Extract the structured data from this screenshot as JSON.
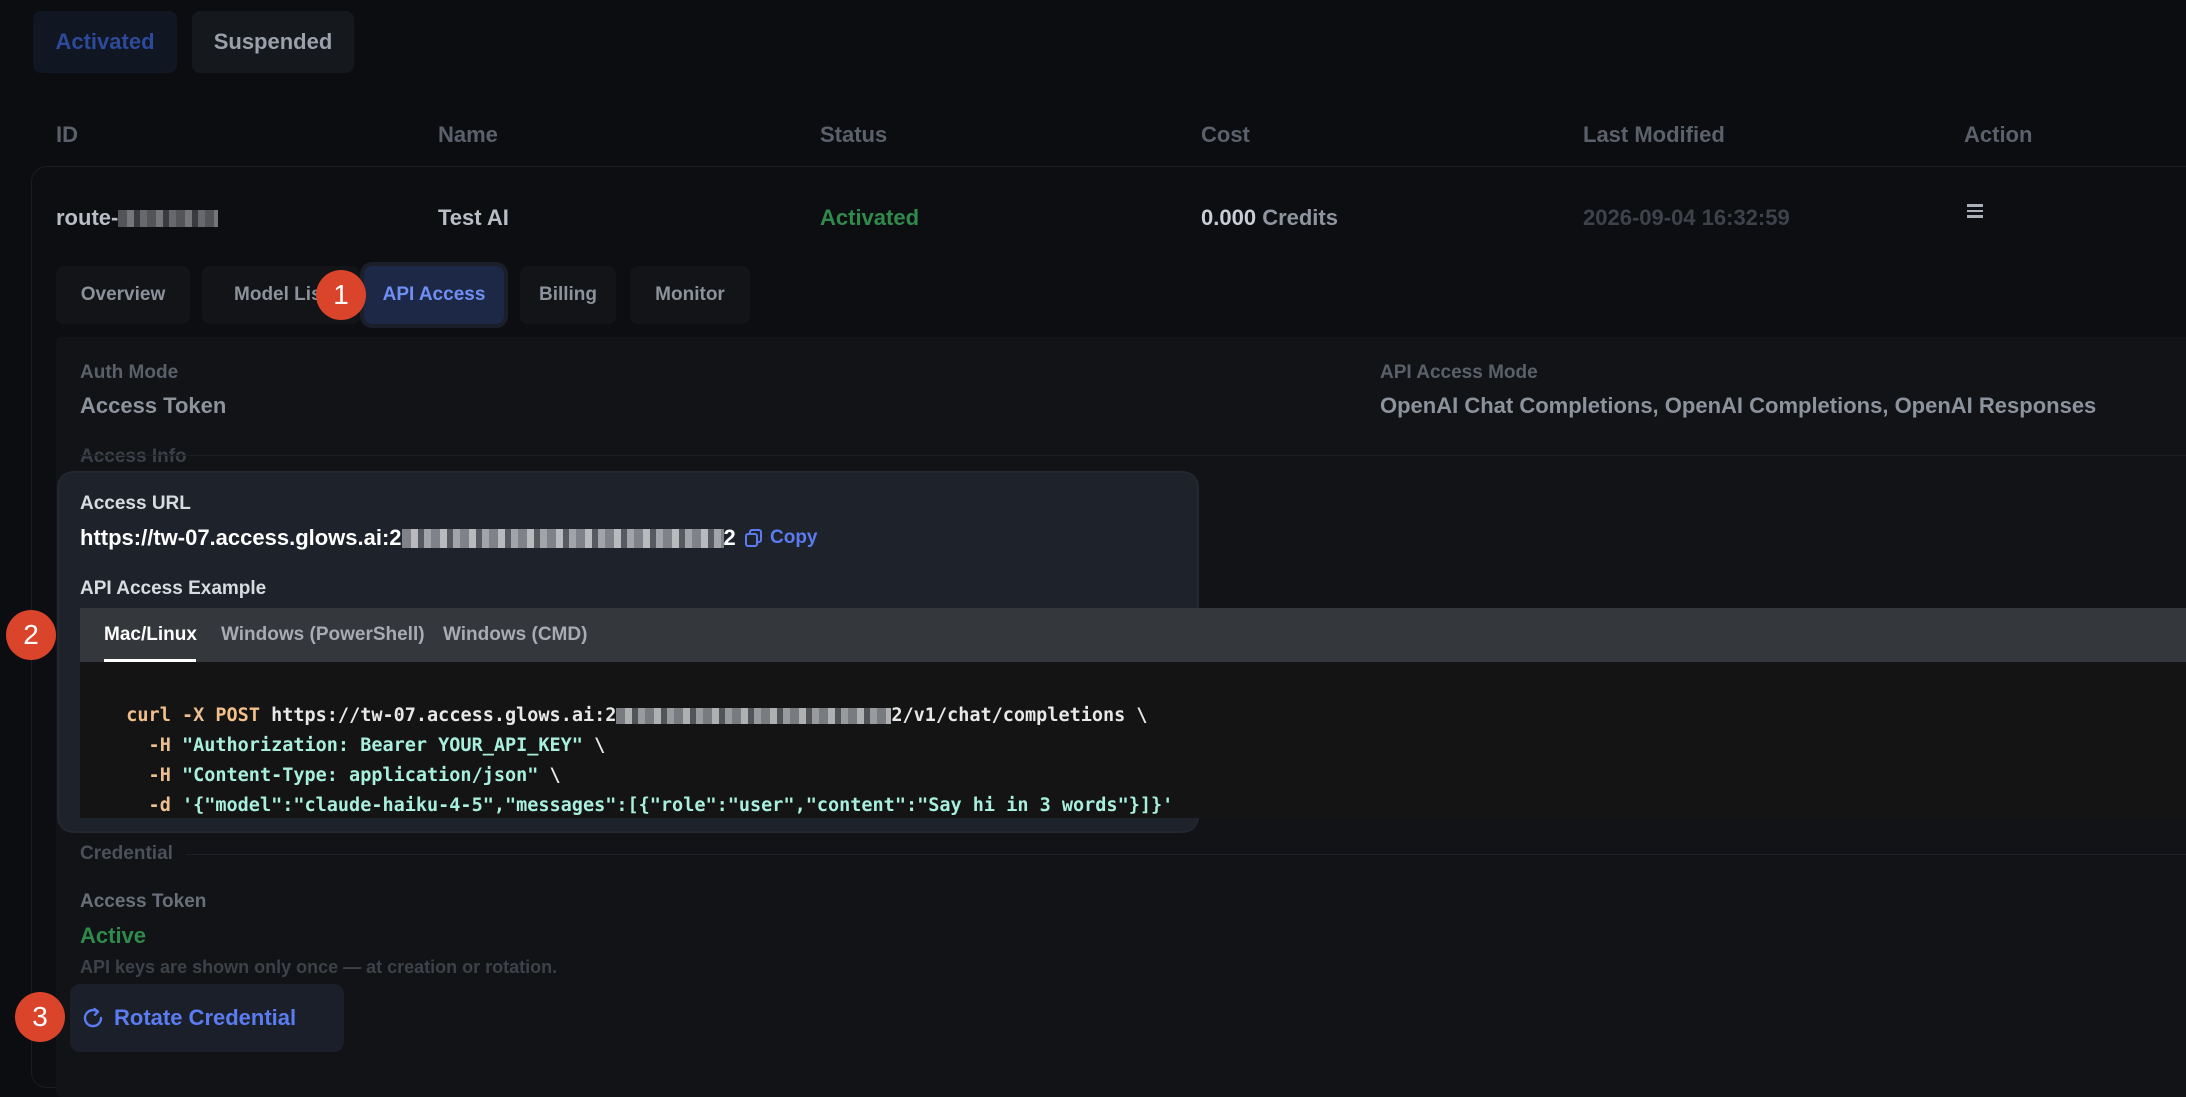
{
  "status_tabs": {
    "activated": "Activated",
    "suspended": "Suspended"
  },
  "table": {
    "headers": [
      "ID",
      "Name",
      "Status",
      "Cost",
      "Last Modified",
      "Action"
    ],
    "row": {
      "id": "route-",
      "name": "Test AI",
      "status": "Activated",
      "cost_value": "0.000",
      "cost_unit": "Credits",
      "last_modified": "2026-09-04 16:32:59",
      "action_icon": "menu-icon"
    }
  },
  "sub_tabs": [
    "Overview",
    "Model List",
    "API Access",
    "Billing",
    "Monitor"
  ],
  "api_access": {
    "auth_mode_label": "Auth Mode",
    "auth_mode_value": "Access Token",
    "api_mode_label": "API Access Mode",
    "api_mode_value": "OpenAI Chat Completions, OpenAI Completions, OpenAI Responses",
    "access_info_label": "Access Info",
    "access_url_label": "Access URL",
    "access_url_prefix": "https://tw-07.access.glows.ai:2",
    "access_url_suffix": "2",
    "copy_label": "Copy",
    "example_label": "API Access Example",
    "code_tabs": [
      "Mac/Linux",
      "Windows (PowerShell)",
      "Windows (CMD)"
    ],
    "code": {
      "l1_cmd": "curl",
      "l1_flag": " -X ",
      "l1_method": "POST",
      "l1_url_prefix": " https://tw-07.access.glows.ai:2",
      "l1_url_suffix": "2/v1/chat/completions \\",
      "l2_flag": "  -H ",
      "l2_str": "\"Authorization: Bearer YOUR_API_KEY\"",
      "l2_tail": " \\",
      "l3_flag": "  -H ",
      "l3_str": "\"Content-Type: application/json\"",
      "l3_tail": " \\",
      "l4_flag": "  -d ",
      "l4_str": "'{\"model\":\"claude-haiku-4-5\",\"messages\":[{\"role\":\"user\",\"content\":\"Say hi in 3 words\"}]}'"
    },
    "credential_label": "Credential",
    "access_token_label": "Access Token",
    "access_token_status": "Active",
    "note": "API keys are shown only once — at creation or rotation.",
    "rotate_label": "Rotate Credential"
  },
  "badges": [
    "1",
    "2",
    "3"
  ],
  "colors": {
    "accent": "#5b7cf0",
    "active_green": "#2f8a4c",
    "badge": "#d9442b"
  }
}
